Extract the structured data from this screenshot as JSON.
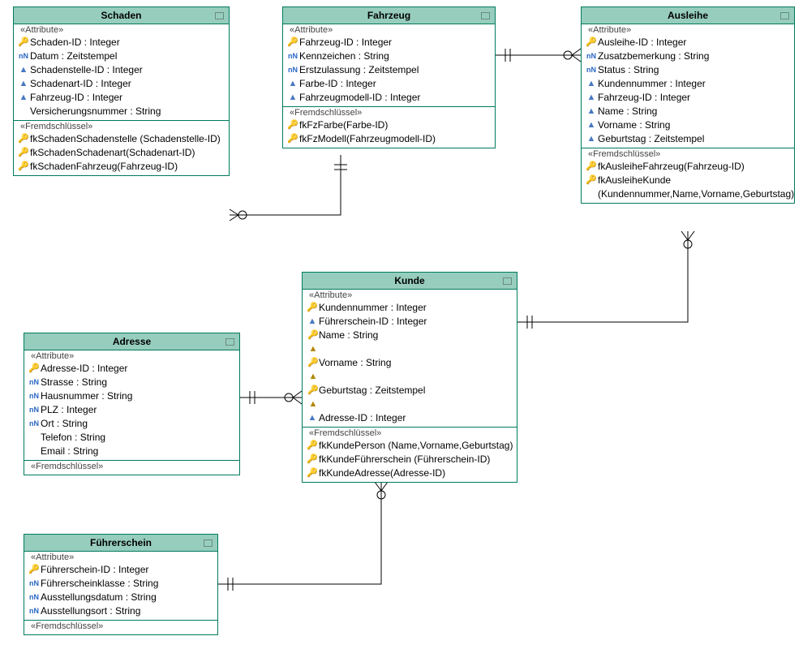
{
  "entities": {
    "schaden": {
      "title": "Schaden",
      "attr_label": "«Attribute»",
      "fk_label": "«Fremdschlüssel»",
      "attrs": [
        {
          "icon": "pk",
          "text": "Schaden-ID : Integer"
        },
        {
          "icon": "nn",
          "text": "Datum : Zeitstempel"
        },
        {
          "icon": "blk",
          "text": "Schadenstelle-ID : Integer"
        },
        {
          "icon": "blk",
          "text": "Schadenart-ID : Integer"
        },
        {
          "icon": "blk",
          "text": "Fahrzeug-ID : Integer"
        },
        {
          "icon": "",
          "text": "Versicherungsnummer : String"
        }
      ],
      "fks": [
        {
          "text": "fkSchadenSchadenstelle (Schadenstelle-ID)"
        },
        {
          "text": "fkSchadenSchadenart(Schadenart-ID)"
        },
        {
          "text": "fkSchadenFahrzeug(Fahrzeug-ID)"
        }
      ]
    },
    "fahrzeug": {
      "title": "Fahrzeug",
      "attr_label": "«Attribute»",
      "fk_label": "«Fremdschlüssel»",
      "attrs": [
        {
          "icon": "pk",
          "text": "Fahrzeug-ID : Integer"
        },
        {
          "icon": "nn",
          "text": "Kennzeichen : String"
        },
        {
          "icon": "nn",
          "text": "Erstzulassung : Zeitstempel"
        },
        {
          "icon": "blk",
          "text": "Farbe-ID : Integer"
        },
        {
          "icon": "blk",
          "text": "Fahrzeugmodell-ID : Integer"
        }
      ],
      "fks": [
        {
          "text": "fkFzFarbe(Farbe-ID)"
        },
        {
          "text": "fkFzModell(Fahrzeugmodell-ID)"
        }
      ]
    },
    "ausleihe": {
      "title": "Ausleihe",
      "attr_label": "«Attribute»",
      "fk_label": "«Fremdschlüssel»",
      "attrs": [
        {
          "icon": "pk",
          "text": "Ausleihe-ID : Integer"
        },
        {
          "icon": "nn",
          "text": "Zusatzbemerkung : String"
        },
        {
          "icon": "nn",
          "text": "Status : String"
        },
        {
          "icon": "blk",
          "text": "Kundennummer : Integer"
        },
        {
          "icon": "blk",
          "text": "Fahrzeug-ID : Integer"
        },
        {
          "icon": "blk",
          "text": "Name : String"
        },
        {
          "icon": "blk",
          "text": "Vorname : String"
        },
        {
          "icon": "blk",
          "text": "Geburtstag : Zeitstempel"
        }
      ],
      "fks": [
        {
          "text": "fkAusleiheFahrzeug(Fahrzeug-ID)"
        },
        {
          "text": "fkAusleiheKunde (Kundennummer,Name,Vorname,Geburtstag)"
        }
      ]
    },
    "kunde": {
      "title": "Kunde",
      "attr_label": "«Attribute»",
      "fk_label": "«Fremdschlüssel»",
      "attrs": [
        {
          "icon": "pk",
          "text": "Kundennummer : Integer"
        },
        {
          "icon": "blk",
          "text": "Führerschein-ID : Integer"
        },
        {
          "icon": "two",
          "text": "Name : String"
        },
        {
          "icon": "two",
          "text": "Vorname : String"
        },
        {
          "icon": "two",
          "text": "Geburtstag : Zeitstempel"
        },
        {
          "icon": "blk",
          "text": "Adresse-ID : Integer"
        }
      ],
      "fks": [
        {
          "text": "fkKundePerson (Name,Vorname,Geburtstag)"
        },
        {
          "text": "fkKundeFührerschein (Führerschein-ID)"
        },
        {
          "text": "fkKundeAdresse(Adresse-ID)"
        }
      ]
    },
    "adresse": {
      "title": "Adresse",
      "attr_label": "«Attribute»",
      "fk_label": "«Fremdschlüssel»",
      "attrs": [
        {
          "icon": "pk",
          "text": "Adresse-ID : Integer"
        },
        {
          "icon": "nn",
          "text": "Strasse : String"
        },
        {
          "icon": "nn",
          "text": "Hausnummer : String"
        },
        {
          "icon": "nn",
          "text": "PLZ : Integer"
        },
        {
          "icon": "nn",
          "text": "Ort : String"
        },
        {
          "icon": "",
          "text": "Telefon : String"
        },
        {
          "icon": "",
          "text": "Email : String"
        }
      ],
      "fks": []
    },
    "fuehrerschein": {
      "title": "Führerschein",
      "attr_label": "«Attribute»",
      "fk_label": "«Fremdschlüssel»",
      "attrs": [
        {
          "icon": "pk",
          "text": "Führerschein-ID : Integer"
        },
        {
          "icon": "nn",
          "text": "Führerscheinklasse : String"
        },
        {
          "icon": "nn",
          "text": "Ausstellungsdatum : String"
        },
        {
          "icon": "nn",
          "text": "Ausstellungsort : String"
        }
      ],
      "fks": []
    }
  },
  "relationships": [
    {
      "from": "Schaden",
      "to": "Fahrzeug",
      "from_card": "0..*",
      "to_card": "1..1"
    },
    {
      "from": "Fahrzeug",
      "to": "Ausleihe",
      "from_card": "1..1",
      "to_card": "0..*"
    },
    {
      "from": "Ausleihe",
      "to": "Kunde",
      "from_card": "0..*",
      "to_card": "1..1"
    },
    {
      "from": "Kunde",
      "to": "Adresse",
      "from_card": "0..*",
      "to_card": "1..1"
    },
    {
      "from": "Kunde",
      "to": "Führerschein",
      "from_card": "0..*",
      "to_card": "1..1"
    }
  ]
}
